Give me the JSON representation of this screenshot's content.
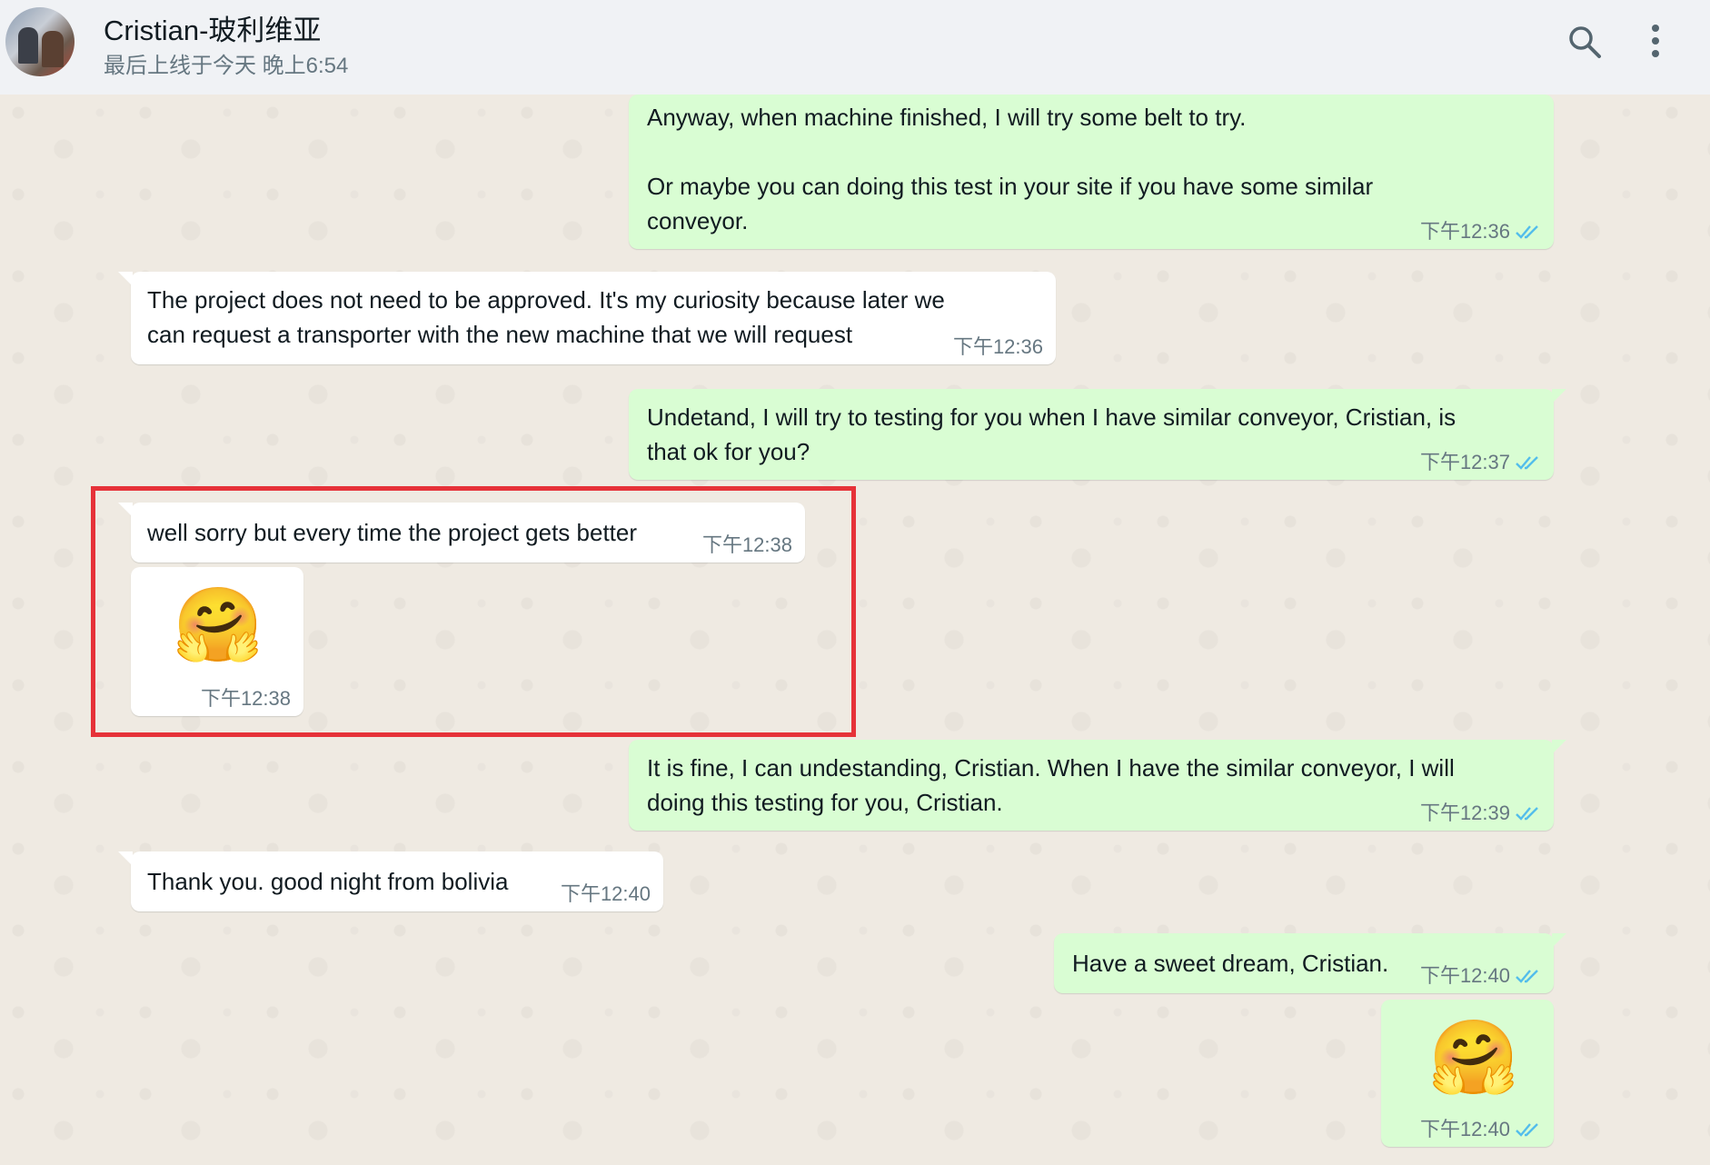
{
  "header": {
    "contact_name": "Cristian-玻利维亚",
    "last_seen": "最后上线于今天 晚上6:54"
  },
  "messages": [
    {
      "direction": "out",
      "text_lines": [
        "Anyway, when machine finished, I will try some belt to try.",
        "",
        "Or maybe you can doing this test in your site if you have some similar",
        "conveyor."
      ],
      "time": "下午12:36",
      "read": true
    },
    {
      "direction": "in",
      "text_lines": [
        "The project does not need to be approved. It's my curiosity because later we",
        "can request a transporter with the new machine that we will request"
      ],
      "time": "下午12:36"
    },
    {
      "direction": "out",
      "text_lines": [
        "Undetand, I will try to testing for you when I have similar conveyor, Cristian, is",
        "that ok for you?"
      ],
      "time": "下午12:37",
      "read": true
    },
    {
      "direction": "in",
      "text_lines": [
        "well sorry but every time the project gets better"
      ],
      "time": "下午12:38"
    },
    {
      "direction": "in",
      "emoji": "🤗",
      "time": "下午12:38"
    },
    {
      "direction": "out",
      "text_lines": [
        "It is fine, I can undestanding, Cristian. When I have the similar conveyor, I will",
        "doing this testing for you, Cristian."
      ],
      "time": "下午12:39",
      "read": true
    },
    {
      "direction": "in",
      "text_lines": [
        "Thank you. good night from bolivia"
      ],
      "time": "下午12:40"
    },
    {
      "direction": "out",
      "text_lines": [
        "Have a sweet dream, Cristian."
      ],
      "time": "下午12:40",
      "read": true
    },
    {
      "direction": "out",
      "emoji": "🤗",
      "time": "下午12:40",
      "read": true
    }
  ],
  "colors": {
    "outgoing_bubble": "#d9fdd3",
    "incoming_bubble": "#ffffff",
    "read_ticks": "#53bdeb",
    "highlight_box": "#e63239",
    "chat_background": "#efeae2"
  },
  "icons": {
    "search": "search-icon",
    "menu": "more-vertical-icon",
    "read_receipt": "double-check-icon"
  }
}
